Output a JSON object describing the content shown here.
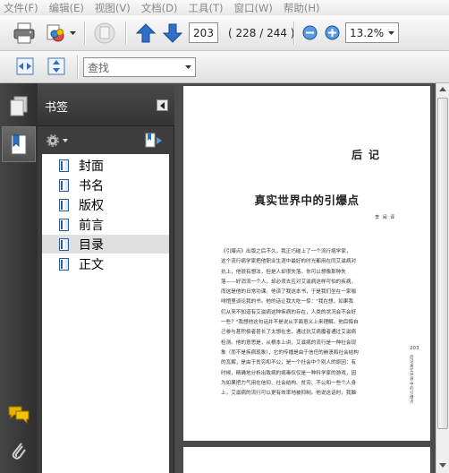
{
  "menu": [
    "文件(F)",
    "编辑(E)",
    "视图(V)",
    "文档(D)",
    "工具(T)",
    "窗口(W)",
    "帮助(H)"
  ],
  "toolbar": {
    "current_page": "203",
    "page_total": "( 228 / 244 )",
    "zoom": "13.2%",
    "search_placeholder": "查找"
  },
  "bookmarks": {
    "title": "书签",
    "items": [
      "封面",
      "书名",
      "版权",
      "前言",
      "目录",
      "正文"
    ],
    "selected_index": 4
  },
  "document": {
    "header": "后记",
    "title": "真实世界中的引爆点",
    "author": "李  闹  译",
    "body_lines": [
      "《引爆点》出版之后不久，我正巧碰上了一个流行病学家，",
      "这个流行病学家把他职业生涯中最好的时光都用在同艾滋病对",
      "抗上，他很有想法，但是人却很失落。你可以想像那种失",
      "落——好消流一个人，却必须去应对艾滋病这样可怕的疾病，",
      "而这是他的日常功课。他读了我这本书，于是我们坐在一家咖",
      "啡馆里谈论我的书。他的话让我大吃一惊：\"我在想，如果我",
      "们从来不知道有艾滋病这种疾病的存在，人类的状况会不会好",
      "一些？\"我想他这句话并不是说从字面意义上来理解。他后悔自",
      "己参与甚积极者甚长了太想在舍，通过抗艾病魔者通过艾滋病",
      "检测。他的意思是，从根本上讲，艾滋病的流行是一种社会现",
      "象（而不是疾病现象），它的传播是由于信任的崩溃和社会结构",
      "的瓦解，是由于贫穷和不公，是一个社会中个别人的原因：有",
      "时候，精确地分析出致病的病毒仅仅是一种科学家的游戏，因",
      "为如果把力气用在信仰、社会结构、贫穷、不公和一些个人身",
      "上，艾滋病的流行可以更有效率地被抑制。他说这话时，我脑"
    ],
    "page_number": "203",
    "side_note": "后记  真实世界中的引爆点"
  },
  "colors": {
    "dark_panel": "#3d3d3d",
    "doc_background": "#4b4b4b",
    "icon_blue": "#2f6fc9",
    "icon_yellow": "#f2c300"
  }
}
